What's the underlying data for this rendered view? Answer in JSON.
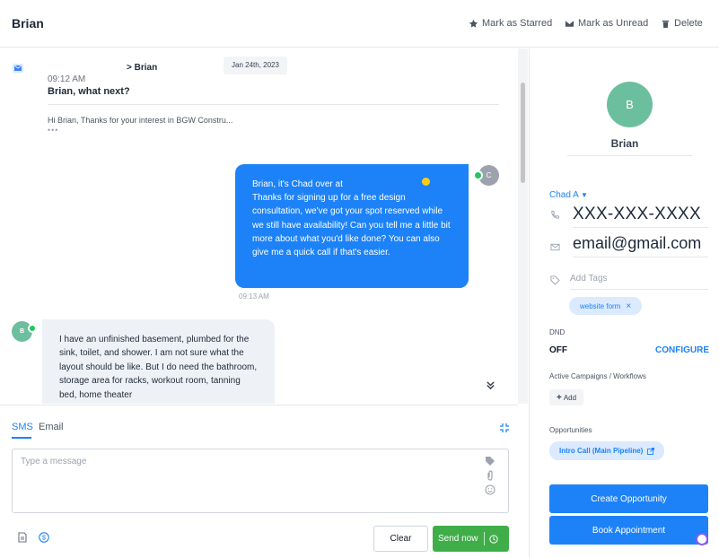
{
  "header": {
    "title": "Brian",
    "actions": [
      {
        "label": "Mark as Starred",
        "icon": "star-icon"
      },
      {
        "label": "Mark as Unread",
        "icon": "envelope-icon"
      },
      {
        "label": "Delete",
        "icon": "trash-icon"
      }
    ]
  },
  "conversation": {
    "email": {
      "to": "> Brian",
      "date": "Jan 24th, 2023",
      "time": "09:12 AM",
      "subject": "Brian, what next?",
      "preview": "Hi Brian, Thanks for your interest in BGW Constru...",
      "more": "•••"
    },
    "outgoing": {
      "text": "Brian, it's Chad over at\nThanks for signing up for a free design consultation, we've got your spot reserved while we still have availability! Can you tell me a little bit more about what you'd like done? You can also give me a quick call if that's easier.",
      "time": "09:13 AM"
    },
    "incoming": {
      "avatar_initial": "B",
      "text": "I have an unfinished basement, plumbed for the sink, toilet, and shower. I am not sure what the layout should be like. But I do need the bathroom, storage area for racks, workout room, tanning bed, home theater"
    }
  },
  "compose": {
    "tabs": [
      "SMS",
      "Email"
    ],
    "active_tab": "SMS",
    "placeholder": "Type a message",
    "clear_label": "Clear",
    "send_label": "Send now"
  },
  "contact": {
    "avatar_initial": "B",
    "name": "Brian",
    "owner": "Chad A",
    "phone": "XXX-XXX-XXXX",
    "email": "email@gmail.com",
    "tags_placeholder": "Add Tags",
    "tags": [
      "website form"
    ],
    "dnd_label": "DND",
    "dnd_value": "OFF",
    "configure_label": "CONFIGURE",
    "campaigns_label": "Active Campaigns / Workflows",
    "add_label": "Add",
    "opportunities_label": "Opportunities",
    "opportunity": "Intro Call (Main Pipeline)",
    "create_opportunity_label": "Create Opportunity",
    "book_appointment_label": "Book Appointment"
  },
  "colors": {
    "accent": "#1d82f7",
    "send_green": "#3fae49",
    "avatar_green": "#6cbf9e",
    "incoming_bg": "#eef2f7"
  }
}
